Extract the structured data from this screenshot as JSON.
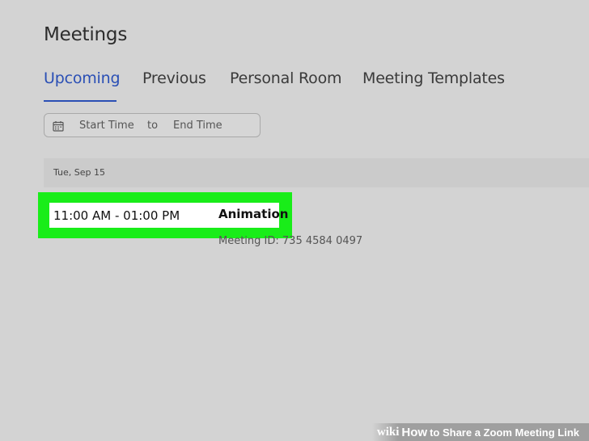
{
  "header": {
    "title": "Meetings"
  },
  "tabs": [
    {
      "label": "Upcoming",
      "active": true
    },
    {
      "label": "Previous",
      "active": false
    },
    {
      "label": "Personal Room",
      "active": false
    },
    {
      "label": "Meeting Templates",
      "active": false
    }
  ],
  "filter": {
    "icon": "calendar-icon",
    "start_placeholder": "Start Time",
    "separator": "to",
    "end_placeholder": "End Time"
  },
  "meetings_list": {
    "date_header": "Tue, Sep 15",
    "items": [
      {
        "time": "11:00 AM - 01:00 PM",
        "topic": "Animation",
        "meeting_id": "Meeting ID: 735 4584 0497"
      }
    ]
  },
  "highlight_color": "#19ed19",
  "accent_color": "#2a4fb5",
  "watermark": {
    "wiki": "wiki",
    "how": "How",
    "rest": "to Share a Zoom Meeting Link"
  }
}
